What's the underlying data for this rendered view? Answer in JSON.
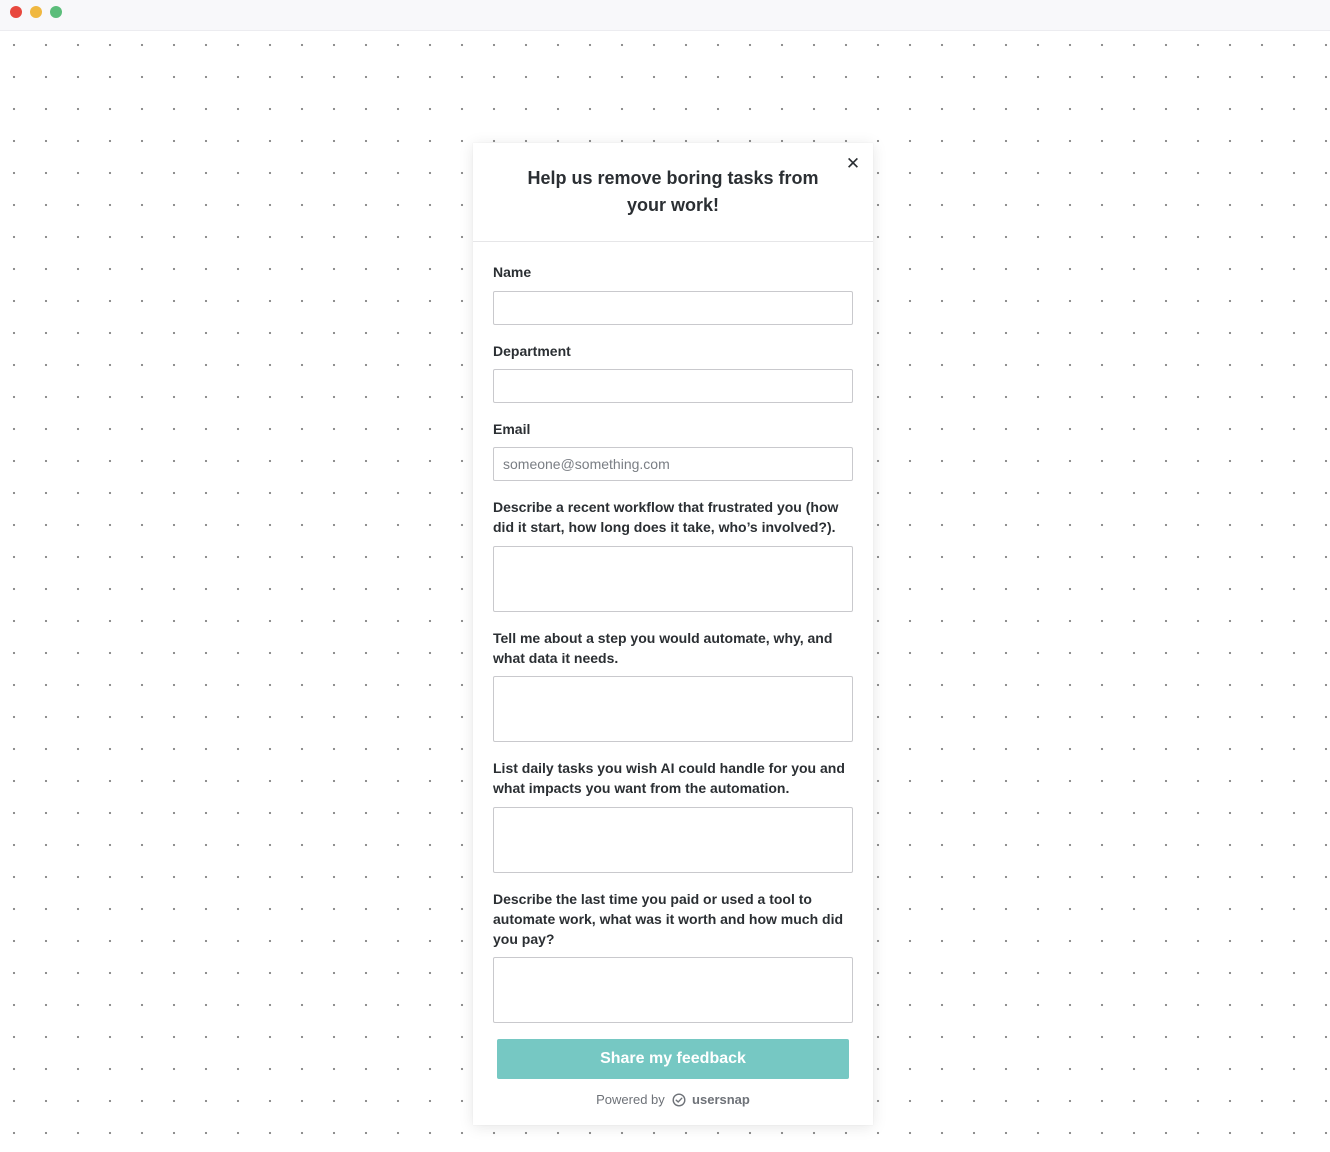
{
  "window": {
    "controls": [
      "close",
      "minimize",
      "maximize"
    ]
  },
  "widget": {
    "title": "Help us remove boring tasks from your work!",
    "close_icon": "close-icon",
    "fields": {
      "name": {
        "label": "Name",
        "value": "",
        "placeholder": ""
      },
      "department": {
        "label": "Department",
        "value": "",
        "placeholder": ""
      },
      "email": {
        "label": "Email",
        "value": "",
        "placeholder": "someone@something.com"
      },
      "workflow": {
        "label": "Describe a recent workflow that frustrated you (how did it start, how long does it take, who’s involved?).",
        "value": ""
      },
      "automate_step": {
        "label": "Tell me about a step you would automate, why, and what data it needs.",
        "value": ""
      },
      "daily_tasks": {
        "label": "List daily tasks you wish AI could handle for you and what impacts you want from the automation.",
        "value": ""
      },
      "last_tool": {
        "label": "Describe the last time you paid or used a tool to automate work, what was it worth and how much did you pay?",
        "value": ""
      }
    },
    "submit_label": "Share my feedback",
    "powered_by": "Powered by",
    "brand": "usersnap",
    "colors": {
      "submit_bg": "#76c8c3",
      "text": "#2b2f33"
    }
  }
}
